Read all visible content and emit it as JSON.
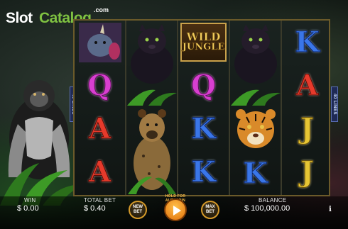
{
  "logo": {
    "part1": "Slot",
    "part2": "Catalog",
    "suffix": ".com"
  },
  "wild_symbol": {
    "line1": "WILD",
    "line2": "JUNGLE"
  },
  "lines_badge": {
    "left": "40 LINES",
    "right": "40 LINES"
  },
  "reels": [
    [
      "rhino",
      "Q",
      "A",
      "A"
    ],
    [
      "panther",
      "ferns",
      "hyena",
      "grass"
    ],
    [
      "wild",
      "Q",
      "K",
      "K"
    ],
    [
      "panther",
      "ferns",
      "tiger",
      "K"
    ],
    [
      "K",
      "A",
      "J",
      "J"
    ]
  ],
  "footer": {
    "win_label": "WIN",
    "win_value": "$ 0.00",
    "total_bet_label": "TOTAL BET",
    "total_bet_value": "$ 0.40",
    "new_bet": "NEW BET",
    "hold_autospin": "HOLD FOR AUTOSPIN",
    "max_bet": "MAX BET",
    "balance_label": "BALANCE",
    "balance_value": "$ 100,000.00",
    "info": "i"
  },
  "colors": {
    "accent": "#d59a2a",
    "logo_green": "#7fc241",
    "spin": "#f29a2a"
  }
}
